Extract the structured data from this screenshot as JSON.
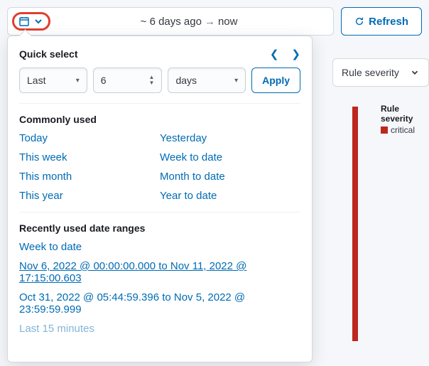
{
  "topbar": {
    "range_from": "~ 6 days ago",
    "range_to": "now",
    "refresh": "Refresh"
  },
  "filters": {
    "severity_label": "Rule severity"
  },
  "legend": {
    "title": "Rule severity",
    "item": "critical"
  },
  "popover": {
    "quick_select": "Quick select",
    "tense": "Last",
    "amount": "6",
    "unit": "days",
    "apply": "Apply",
    "common_title": "Commonly used",
    "common": {
      "today": "Today",
      "yesterday": "Yesterday",
      "this_week": "This week",
      "week_to_date": "Week to date",
      "this_month": "This month",
      "month_to_date": "Month to date",
      "this_year": "This year",
      "year_to_date": "Year to date"
    },
    "recent_title": "Recently used date ranges",
    "recent": [
      "Week to date",
      "Nov 6, 2022 @ 00:00:00.000 to Nov 11, 2022 @ 17:15:00.603",
      "Oct 31, 2022 @ 05:44:59.396 to Nov 5, 2022 @ 23:59:59.999",
      "Last 15 minutes"
    ]
  }
}
